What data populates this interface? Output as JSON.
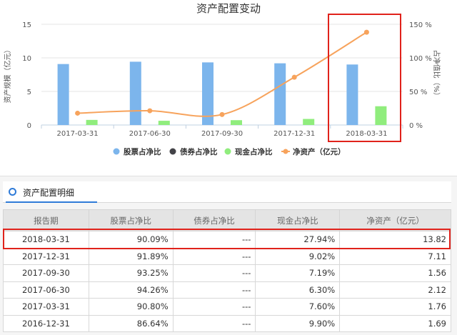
{
  "chart_data": {
    "type": "bar",
    "title": "资产配置变动",
    "categories": [
      "2017-03-31",
      "2017-06-30",
      "2017-09-30",
      "2017-12-31",
      "2018-03-31"
    ],
    "y_left_label": "资产规模（亿元）",
    "y_left_ticks": [
      "0",
      "5",
      "10",
      "15"
    ],
    "y_left_lim": [
      0,
      15
    ],
    "y_right_label": "占净值比（%）",
    "y_right_ticks": [
      "0 %",
      "50 %",
      "100 %",
      "150 %"
    ],
    "y_right_lim": [
      0,
      150
    ],
    "grid": true,
    "legend_position": "bottom",
    "series": [
      {
        "name": "股票占净比",
        "type": "bar",
        "axis": "right",
        "color": "#7cb5ec",
        "values": [
          90.8,
          94.26,
          93.25,
          91.89,
          90.09
        ]
      },
      {
        "name": "债券占净比",
        "type": "bar",
        "axis": "right",
        "color": "#434348",
        "values": [
          0,
          0,
          0,
          0,
          0
        ]
      },
      {
        "name": "现金占净比",
        "type": "bar",
        "axis": "right",
        "color": "#90ed7d",
        "values": [
          7.6,
          6.3,
          7.19,
          9.02,
          27.94
        ]
      },
      {
        "name": "净资产（亿元）",
        "type": "line",
        "axis": "left",
        "color": "#f7a35c",
        "values": [
          1.76,
          2.12,
          1.56,
          7.11,
          13.82
        ]
      }
    ]
  },
  "section": {
    "title": "资产配置明细"
  },
  "table": {
    "headers": [
      "报告期",
      "股票占净比",
      "债券占净比",
      "现金占净比",
      "净资产（亿元）"
    ],
    "rows": [
      [
        "2018-03-31",
        "90.09%",
        "---",
        "27.94%",
        "13.82"
      ],
      [
        "2017-12-31",
        "91.89%",
        "---",
        "9.02%",
        "7.11"
      ],
      [
        "2017-09-30",
        "93.25%",
        "---",
        "7.19%",
        "1.56"
      ],
      [
        "2017-06-30",
        "94.26%",
        "---",
        "6.30%",
        "2.12"
      ],
      [
        "2017-03-31",
        "90.80%",
        "---",
        "7.60%",
        "1.76"
      ],
      [
        "2016-12-31",
        "86.64%",
        "---",
        "9.90%",
        "1.69"
      ]
    ]
  },
  "colors": {
    "highlight": "#e0221b",
    "accent": "#2f7bd8"
  }
}
